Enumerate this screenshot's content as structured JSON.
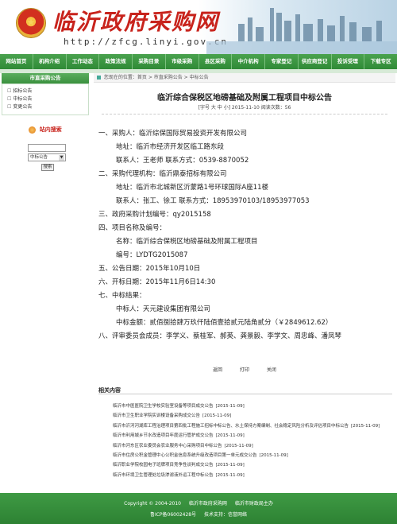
{
  "header": {
    "site_title": "临沂政府采购网",
    "site_url": "http://zfcg.linyi.gov.cn"
  },
  "nav": [
    "网站首页",
    "机构介绍",
    "工作动态",
    "政策法规",
    "采购目录",
    "市级采购",
    "县区采购",
    "中介机构",
    "专家登记",
    "供应商登记",
    "投诉受理",
    "下载专区"
  ],
  "sidebar": {
    "title": "市直采购公告",
    "items": [
      "招标公告",
      "中标公告",
      "变更公告"
    ]
  },
  "search": {
    "title": "站内搜索",
    "select_value": "中标公告",
    "button_label": "搜索"
  },
  "breadcrumb": "您现在的位置：首页 > 市直采购公告 > 中标公告",
  "article": {
    "title": "临沂综合保税区地磅基础及附属工程项目中标公告",
    "meta": "[字号  大  中  小]  2015-11-10      阅读次数：56",
    "lines": [
      "一、采购人：临沂综保国际贸易投资开发有限公司",
      "地址：临沂市经济开发区临工路东段",
      "联系人：王老师          联系方式：0539-8870052",
      "二、采购代理机构：临沂鼎泰招标有限公司",
      "地址：临沂市北城新区沂蒙路1号环球国际A座11楼",
      "联系人：张工、徐工      联系方式：18953970103/18953977053",
      "三、政府采购计划编号：qy2015158",
      "四、项目名称及编号：",
      "名称：临沂综合保税区地磅基础及附属工程项目",
      "编号：LYDTG2015087",
      "五、公告日期：2015年10月10日",
      "六、开标日期：2015年11月6日14:30",
      "七、中标结果：",
      "中标人：天元建设集团有限公司",
      "中标金额：贰佰捌拾肆万玖仟陆佰壹拾贰元陆角贰分（￥2849612.62）",
      "八、评审委员会成员：李学义、蔡桂军、郝英、龚景毅、李学文、周忠峰、潘凤琴"
    ],
    "indented": [
      false,
      true,
      true,
      false,
      true,
      true,
      false,
      false,
      true,
      true,
      false,
      false,
      false,
      true,
      true,
      false
    ]
  },
  "actions": [
    "返回",
    "打印",
    "关闭"
  ],
  "related": {
    "title": "相关内容",
    "items": [
      {
        "text": "临沂市中医医院卫生学校实验室设备等项目成交公告",
        "date": "[2015-11-09]"
      },
      {
        "text": "临沂市卫生职业学院实训楼设备采购成交公告",
        "date": "[2015-11-09]"
      },
      {
        "text": "临沂市沂河河湖库工程治理项目第四批工程施工招标中标公告、水土保持方案编制、社会稳定风险分析及评估项目中标公告",
        "date": "[2015-11-09]"
      },
      {
        "text": "临沂市利用城乡节水改造项目年度运行管护成交公告",
        "date": "[2015-11-09]"
      },
      {
        "text": "临沂市河东区农业委员会农业服务中心采购项目中标公告",
        "date": "[2015-11-09]"
      },
      {
        "text": "临沂市住房公积金管理中心公积金信息系统升级改造项目第一单元成交公告",
        "date": "[2015-11-09]"
      },
      {
        "text": "临沂职业学院校园电子班牌项目竞争性谈判成交公告",
        "date": "[2015-11-09]"
      },
      {
        "text": "临沂市环境卫生管理处垃圾渗滤液外运工程中标公告",
        "date": "[2015-11-09]"
      }
    ]
  },
  "footer": {
    "line1": [
      "Copyright © 2004-2010",
      "临沂市政府采购网",
      "临沂市财政局主办"
    ],
    "line2": [
      "鲁ICP备06002428号",
      "技术支持：信誉网络"
    ]
  },
  "colors": {
    "nav_green": "#2f8a36",
    "title_red": "#c8231c"
  }
}
